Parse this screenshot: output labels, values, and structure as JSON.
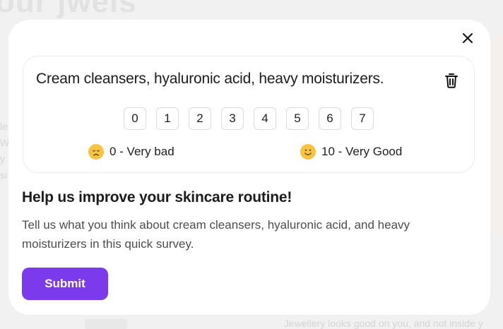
{
  "background": {
    "title": "our jwels",
    "left_chars": [
      "le",
      "W",
      "y",
      "si"
    ],
    "bottom_text": "Jewellery looks good on you, and not inside y"
  },
  "survey": {
    "question": "Cream cleansers, hyaluronic acid, heavy moisturizers.",
    "scale": [
      "0",
      "1",
      "2",
      "3",
      "4",
      "5",
      "6",
      "7"
    ],
    "low_label": "0 - Very bad",
    "high_label": "10 - Very Good",
    "low_icon": "sad-face-icon",
    "high_icon": "smile-face-icon",
    "trash_icon": "trash-icon",
    "close_icon": "close-icon"
  },
  "info": {
    "heading": "Help us improve your skincare routine!",
    "description": "Tell us what you think about cream cleansers, hyaluronic acid, and heavy moisturizers in this quick survey."
  },
  "actions": {
    "submit_label": "Submit"
  },
  "colors": {
    "accent": "#7c3aed",
    "emoji": "#f6c342"
  }
}
